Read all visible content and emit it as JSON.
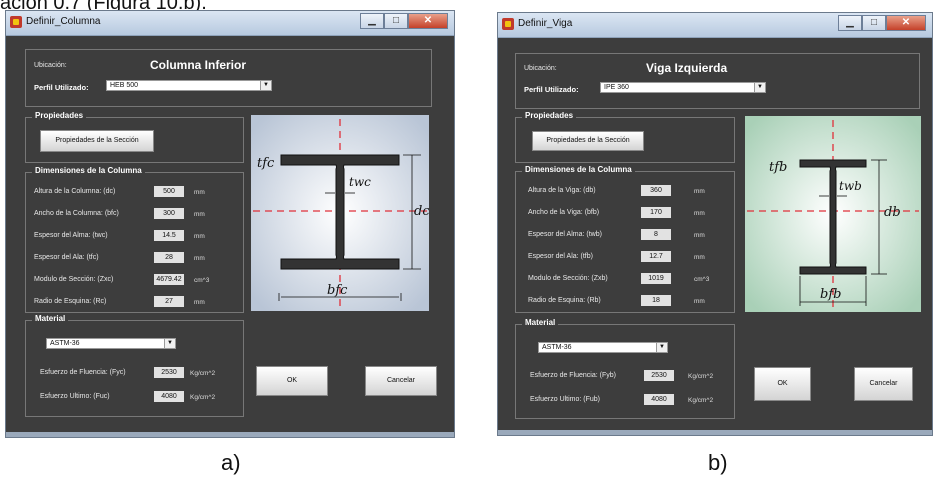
{
  "top_text": "ación 0.7 (Figura 10.b).",
  "captions": [
    "a)",
    "b)"
  ],
  "dialogs": [
    {
      "title": "Definir_Columna",
      "ubicacion_label": "Ubicación:",
      "ubicacion_value": "Columna Inferior",
      "perfil_label": "Perfil Utilizado:",
      "perfil_value": "HEB 500",
      "propiedades_title": "Propiedades",
      "propiedades_button": "Propiedades de la Sección",
      "dimensiones_title": "Dimensiones de la Columna",
      "rows": [
        {
          "label": "Altura de la Columna: (dc)",
          "value": "500",
          "unit": "mm"
        },
        {
          "label": "Ancho de la Columna: (bfc)",
          "value": "300",
          "unit": "mm"
        },
        {
          "label": "Espesor del Alma: (twc)",
          "value": "14.5",
          "unit": "mm"
        },
        {
          "label": "Espesor del Ala: (tfc)",
          "value": "28",
          "unit": "mm"
        },
        {
          "label": "Modulo de Sección: (Zxc)",
          "value": "4679.42",
          "unit": "cm^3"
        },
        {
          "label": "Radio de Esquina: (Rc)",
          "value": "27",
          "unit": "mm"
        }
      ],
      "material_title": "Material",
      "material_value": "ASTM-36",
      "fluencia_label": "Esfuerzo de Fluencia: (Fyc)",
      "fluencia_value": "2530",
      "fluencia_unit": "Kg/cm^2",
      "ultimo_label": "Esfuerzo Ultimo: (Fuc)",
      "ultimo_value": "4080",
      "ultimo_unit": "Kg/cm^2",
      "ok_label": "OK",
      "cancel_label": "Cancelar",
      "diagram": {
        "tf": "tfc",
        "tw": "twc",
        "d": "dc",
        "bf": "bfc",
        "bg_color": "#b9c5d6"
      }
    },
    {
      "title": "Definir_Viga",
      "ubicacion_label": "Ubicación:",
      "ubicacion_value": "Viga Izquierda",
      "perfil_label": "Perfil Utilizado:",
      "perfil_value": "IPE 360",
      "propiedades_title": "Propiedades",
      "propiedades_button": "Propiedades de la Sección",
      "dimensiones_title": "Dimensiones de la Columna",
      "rows": [
        {
          "label": "Altura de la Viga: (db)",
          "value": "360",
          "unit": "mm"
        },
        {
          "label": "Ancho de la Viga: (bfb)",
          "value": "170",
          "unit": "mm"
        },
        {
          "label": "Espesor del Alma: (twb)",
          "value": "8",
          "unit": "mm"
        },
        {
          "label": "Espesor del Ala: (tfb)",
          "value": "12.7",
          "unit": "mm"
        },
        {
          "label": "Modulo de Sección: (Zxb)",
          "value": "1019",
          "unit": "cm^3"
        },
        {
          "label": "Radio de Esquina: (Rb)",
          "value": "18",
          "unit": "mm"
        }
      ],
      "material_title": "Material",
      "material_value": "ASTM-36",
      "fluencia_label": "Esfuerzo de Fluencia: (Fyb)",
      "fluencia_value": "2530",
      "fluencia_unit": "Kg/cm^2",
      "ultimo_label": "Esfuerzo Ultimo: (Fub)",
      "ultimo_value": "4080",
      "ultimo_unit": "Kg/cm^2",
      "ok_label": "OK",
      "cancel_label": "Cancelar",
      "diagram": {
        "tf": "tfb",
        "tw": "twb",
        "d": "db",
        "bf": "bfb",
        "bg_color": "#a9d0b7"
      }
    }
  ]
}
